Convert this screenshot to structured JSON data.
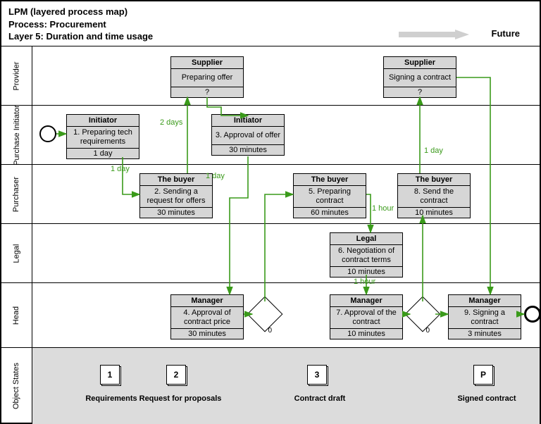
{
  "header": {
    "line1": "LPM (layered process map)",
    "line2": "Process: Procurement",
    "line3": "Layer 5: Duration and time usage",
    "future": "Future"
  },
  "lanes": {
    "provider": "Provider",
    "initiator": "Purchase Initiator",
    "purchaser": "Purchaser",
    "legal": "Legal",
    "head": "Head",
    "objects": "Object States"
  },
  "activities": {
    "supplier1": {
      "role": "Supplier",
      "task": "Preparing offer",
      "dur": "?"
    },
    "supplier2": {
      "role": "Supplier",
      "task": "Signing a contract",
      "dur": "?"
    },
    "initiator1": {
      "role": "Initiator",
      "task": "1. Preparing tech requirements",
      "dur": "1 day"
    },
    "initiator3": {
      "role": "Initiator",
      "task": "3. Approval of offer",
      "dur": "30 minutes"
    },
    "buyer2": {
      "role": "The buyer",
      "task": "2. Sending a request for offers",
      "dur": "30 minutes"
    },
    "buyer5": {
      "role": "The buyer",
      "task": "5. Preparing contract",
      "dur": "60 minutes"
    },
    "buyer8": {
      "role": "The buyer",
      "task": "8. Send the contract",
      "dur": "10 minutes"
    },
    "legal6": {
      "role": "Legal",
      "task": "6. Negotiation of contract terms",
      "dur": "10 minutes"
    },
    "manager4": {
      "role": "Manager",
      "task": "4. Approval of contract price",
      "dur": "30 minutes"
    },
    "manager7": {
      "role": "Manager",
      "task": "7. Approval of the contract",
      "dur": "10 minutes"
    },
    "manager9": {
      "role": "Manager",
      "task": "9. Signing a contract",
      "dur": "3 minutes"
    }
  },
  "flow_labels": {
    "f1": "1 day",
    "f2": "2 days",
    "f3": "1 day",
    "f4": "1 hour",
    "f5": "1 hour",
    "f6": "1 day"
  },
  "gateway_zero": "0",
  "objects": {
    "o1": {
      "tag": "1",
      "label": "Requirements"
    },
    "o2": {
      "tag": "2",
      "label": "Request for proposals"
    },
    "o3": {
      "tag": "3",
      "label": "Contract draft"
    },
    "op": {
      "tag": "P",
      "label": "Signed contract"
    }
  }
}
